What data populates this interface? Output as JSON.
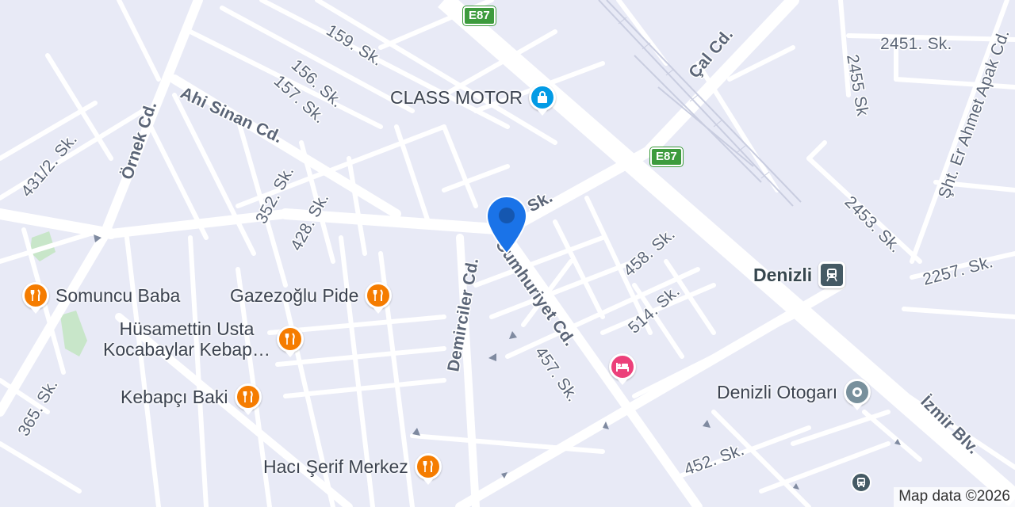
{
  "map": {
    "attribution": "Map data ©2026",
    "highway_shields": [
      "E87",
      "E87"
    ],
    "street_labels": [
      "159. Sk.",
      "156. Sk.",
      "157. Sk.",
      "Ahi Sinan Cd.",
      "Örnek Cd.",
      "431/2. Sk.",
      "352. Sk.",
      "428. Sk.",
      "Sk.",
      "Çal Cd.",
      "2451. Sk.",
      "2455 Sk",
      "Şht. Er Ahmet Apak Cd.",
      "2453. Sk.",
      "2257. Sk.",
      "458. Sk.",
      "514. Sk.",
      "Demirciler Cd.",
      "Cumhuriyet Cd.",
      "457. Sk.",
      "İzmir Blv.",
      "452. Sk.",
      "365. Sk."
    ],
    "pois": [
      {
        "name": "CLASS MOTOR",
        "category": "shopping",
        "icon": "shopping-bag-icon"
      },
      {
        "name": "Somuncu Baba",
        "category": "restaurant",
        "icon": "fork-knife-icon"
      },
      {
        "name": "Gazezoğlu Pide",
        "category": "restaurant",
        "icon": "fork-knife-icon"
      },
      {
        "name": "Hüsamettin Usta",
        "category": "restaurant",
        "icon": "fork-knife-icon"
      },
      {
        "name": "Kocabaylar Kebap…",
        "category": "restaurant",
        "icon": "fork-knife-icon"
      },
      {
        "name": "Kebapçı Baki",
        "category": "restaurant",
        "icon": "fork-knife-icon"
      },
      {
        "name": "Hacı Şerif Merkez",
        "category": "restaurant",
        "icon": "fork-knife-icon"
      },
      {
        "name": "Denizli",
        "category": "train-station",
        "icon": "train-icon"
      },
      {
        "name": "Denizli Otogarı",
        "category": "bus-terminal",
        "icon": "location-dot-icon"
      },
      {
        "name": "",
        "category": "hotel",
        "icon": "bed-icon"
      },
      {
        "name": "",
        "category": "bus-stop",
        "icon": "bus-icon"
      }
    ],
    "selected_marker": {
      "icon": "map-pin-icon",
      "color": "#1a73e8"
    },
    "colors": {
      "background": "#e8eaf6",
      "road": "#ffffff",
      "park": "#c8e6c9",
      "restaurant": "#f57c00",
      "shopping": "#039be5",
      "hotel": "#ec407a",
      "transit": "#455a64",
      "highway_shield": "#3d9b3d"
    }
  }
}
